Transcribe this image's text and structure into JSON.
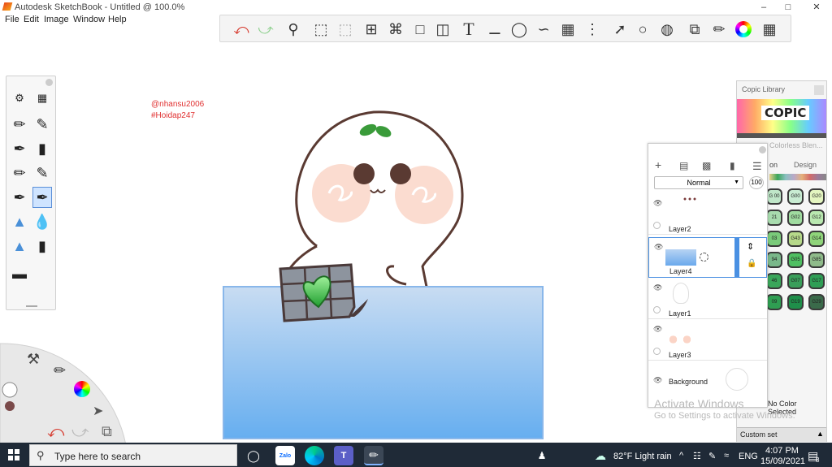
{
  "window": {
    "title": "Autodesk SketchBook - Untitled @ 100.0%"
  },
  "menu": [
    "File",
    "Edit",
    "Image",
    "Window",
    "Help"
  ],
  "toolbar_icons": [
    "undo-icon",
    "redo-icon",
    "zoom-icon",
    "select-icon",
    "select2-icon",
    "crop-icon",
    "lasso-icon",
    "transform-icon",
    "fill-icon",
    "text-icon",
    "ruler-icon",
    "ellipse-guide-icon",
    "curve-icon",
    "perspective-icon",
    "symmetry-icon",
    "stroke-icon",
    "shape-icon",
    "layer-fx-icon",
    "copy-icon",
    "brush-lib-icon",
    "color-wheel-icon",
    "grid-icon"
  ],
  "canvas": {
    "handle1": "@nhansu2006",
    "handle2": "#Hoidap247"
  },
  "layers": {
    "blend_mode": "Normal",
    "opacity": "100",
    "items": [
      {
        "name": "Layer2"
      },
      {
        "name": "Layer4"
      },
      {
        "name": "Layer1"
      },
      {
        "name": "Layer3"
      },
      {
        "name": "Background"
      }
    ]
  },
  "copic": {
    "title": "Copic Library",
    "logo": "COPIC",
    "colorless": "Colorless Blen...",
    "tab_active": "on",
    "tab_design": "Design",
    "swatches": [
      {
        "label": "G\n00",
        "color": "#bfe6c8"
      },
      {
        "label": "G00",
        "color": "#c8ecd2"
      },
      {
        "label": "G20",
        "color": "#e4f5c0"
      },
      {
        "label": "21",
        "color": "#a8dcae"
      },
      {
        "label": "G02",
        "color": "#9fdb9f"
      },
      {
        "label": "G12",
        "color": "#b9e8b0"
      },
      {
        "label": "03",
        "color": "#7acb7a"
      },
      {
        "label": "G43",
        "color": "#b6d98a"
      },
      {
        "label": "G14",
        "color": "#8fd47a"
      },
      {
        "label": "94",
        "color": "#7ab88a"
      },
      {
        "label": "G05",
        "color": "#4fbf62"
      },
      {
        "label": "G85",
        "color": "#8fbb8a"
      },
      {
        "label": "46",
        "color": "#3aa65a"
      },
      {
        "label": "G07",
        "color": "#3a9e5a"
      },
      {
        "label": "G17",
        "color": "#2f9e55"
      },
      {
        "label": "09",
        "color": "#2f9e52"
      },
      {
        "label": "G19",
        "color": "#1f8f4a"
      },
      {
        "label": "G29",
        "color": "#3a6a4a"
      }
    ],
    "no_color": "No Color Selected",
    "custom_set": "Custom set"
  },
  "watermark": {
    "line1": "Activate Windows",
    "line2": "Go to Settings to activate Windows."
  },
  "taskbar": {
    "search_placeholder": "Type here to search",
    "weather": "82°F  Light rain",
    "lang": "ENG",
    "time": "4:07 PM",
    "date": "15/09/2021",
    "notif": "8"
  }
}
